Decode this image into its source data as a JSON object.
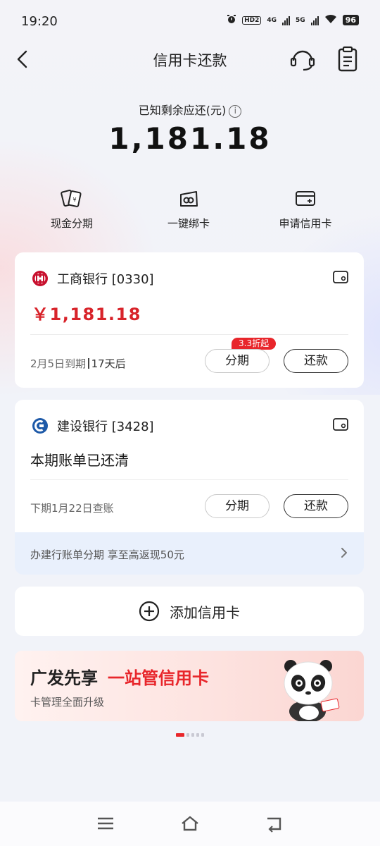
{
  "status_bar": {
    "time": "19:20",
    "hd_label": "HD2",
    "net1": "4G",
    "net2": "5G",
    "battery": "96"
  },
  "header": {
    "title": "信用卡还款",
    "back_icon": "chevron-left-icon",
    "service_icon": "headset-icon",
    "records_icon": "clipboard-icon"
  },
  "summary": {
    "label": "已知剩余应还(元)",
    "amount": "1,181.18"
  },
  "quick_actions": [
    {
      "label": "现金分期",
      "icon": "cash-installment-icon"
    },
    {
      "label": "一键绑卡",
      "icon": "bind-card-icon"
    },
    {
      "label": "申请信用卡",
      "icon": "apply-card-icon"
    }
  ],
  "cards": [
    {
      "bank": "工商银行 [0330]",
      "amount": "￥1,181.18",
      "due_date": "2月5日到期",
      "due_in": "17天后",
      "promo_tag": "3.3折起",
      "installment_label": "分期",
      "repay_label": "还款"
    },
    {
      "bank": "建设银行 [3428]",
      "status": "本期账单已还清",
      "next_bill": "下期1月22日查账",
      "installment_label": "分期",
      "repay_label": "还款",
      "promo": "办建行账单分期 享至高返现50元"
    }
  ],
  "add_card": {
    "label": "添加信用卡"
  },
  "banner": {
    "title_part1": "广发先享",
    "title_part2": "一站管信用卡",
    "subtitle": "卡管理全面升级"
  },
  "colors": {
    "accent_red": "#e8262b",
    "amount_red": "#d8232a",
    "icbc_red": "#c8102e",
    "ccb_blue": "#1e5aa8"
  }
}
